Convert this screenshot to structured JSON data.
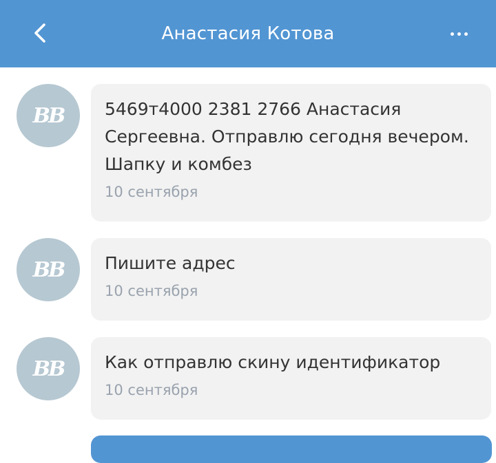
{
  "header": {
    "title": "Анастасия Котова",
    "back_icon": "chevron-left-icon",
    "more_icon": "more-horizontal-icon",
    "background": "#5295d3"
  },
  "messages": [
    {
      "avatar_initials": "ВВ",
      "text": "5469т4000 2381 2766 Анастасия Сергеевна. Отправлю сегодня вечером. Шапку и комбез",
      "date": "10 сентября"
    },
    {
      "avatar_initials": "ВВ",
      "text": "Пишите адрес",
      "date": "10 сентября"
    },
    {
      "avatar_initials": "ВВ",
      "text": "Как отправлю скину идентификатор",
      "date": "10 сентября"
    }
  ],
  "colors": {
    "accent": "#5295d3",
    "bubble": "#f2f2f2",
    "avatar": "#b6c8d2",
    "date_text": "#99a2ad"
  }
}
